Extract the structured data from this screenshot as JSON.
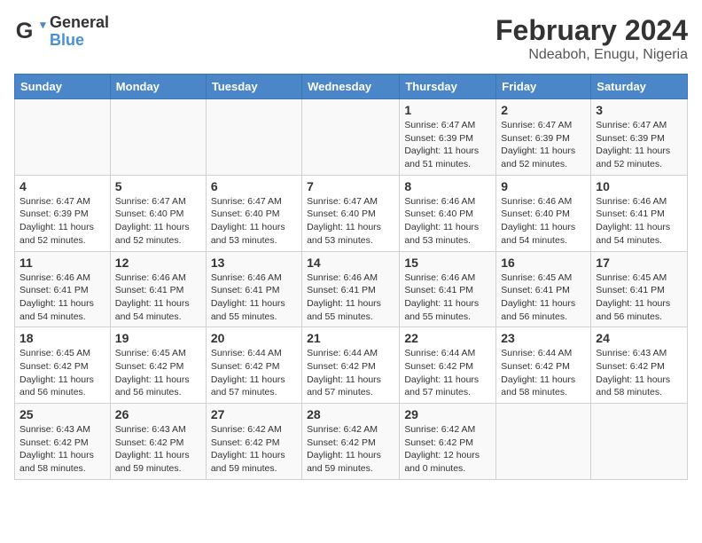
{
  "logo": {
    "line1": "General",
    "line2": "Blue"
  },
  "title": "February 2024",
  "subtitle": "Ndeaboh, Enugu, Nigeria",
  "days_of_week": [
    "Sunday",
    "Monday",
    "Tuesday",
    "Wednesday",
    "Thursday",
    "Friday",
    "Saturday"
  ],
  "weeks": [
    [
      {
        "num": "",
        "info": ""
      },
      {
        "num": "",
        "info": ""
      },
      {
        "num": "",
        "info": ""
      },
      {
        "num": "",
        "info": ""
      },
      {
        "num": "1",
        "info": "Sunrise: 6:47 AM\nSunset: 6:39 PM\nDaylight: 11 hours and 51 minutes."
      },
      {
        "num": "2",
        "info": "Sunrise: 6:47 AM\nSunset: 6:39 PM\nDaylight: 11 hours and 52 minutes."
      },
      {
        "num": "3",
        "info": "Sunrise: 6:47 AM\nSunset: 6:39 PM\nDaylight: 11 hours and 52 minutes."
      }
    ],
    [
      {
        "num": "4",
        "info": "Sunrise: 6:47 AM\nSunset: 6:39 PM\nDaylight: 11 hours and 52 minutes."
      },
      {
        "num": "5",
        "info": "Sunrise: 6:47 AM\nSunset: 6:40 PM\nDaylight: 11 hours and 52 minutes."
      },
      {
        "num": "6",
        "info": "Sunrise: 6:47 AM\nSunset: 6:40 PM\nDaylight: 11 hours and 53 minutes."
      },
      {
        "num": "7",
        "info": "Sunrise: 6:47 AM\nSunset: 6:40 PM\nDaylight: 11 hours and 53 minutes."
      },
      {
        "num": "8",
        "info": "Sunrise: 6:46 AM\nSunset: 6:40 PM\nDaylight: 11 hours and 53 minutes."
      },
      {
        "num": "9",
        "info": "Sunrise: 6:46 AM\nSunset: 6:40 PM\nDaylight: 11 hours and 54 minutes."
      },
      {
        "num": "10",
        "info": "Sunrise: 6:46 AM\nSunset: 6:41 PM\nDaylight: 11 hours and 54 minutes."
      }
    ],
    [
      {
        "num": "11",
        "info": "Sunrise: 6:46 AM\nSunset: 6:41 PM\nDaylight: 11 hours and 54 minutes."
      },
      {
        "num": "12",
        "info": "Sunrise: 6:46 AM\nSunset: 6:41 PM\nDaylight: 11 hours and 54 minutes."
      },
      {
        "num": "13",
        "info": "Sunrise: 6:46 AM\nSunset: 6:41 PM\nDaylight: 11 hours and 55 minutes."
      },
      {
        "num": "14",
        "info": "Sunrise: 6:46 AM\nSunset: 6:41 PM\nDaylight: 11 hours and 55 minutes."
      },
      {
        "num": "15",
        "info": "Sunrise: 6:46 AM\nSunset: 6:41 PM\nDaylight: 11 hours and 55 minutes."
      },
      {
        "num": "16",
        "info": "Sunrise: 6:45 AM\nSunset: 6:41 PM\nDaylight: 11 hours and 56 minutes."
      },
      {
        "num": "17",
        "info": "Sunrise: 6:45 AM\nSunset: 6:41 PM\nDaylight: 11 hours and 56 minutes."
      }
    ],
    [
      {
        "num": "18",
        "info": "Sunrise: 6:45 AM\nSunset: 6:42 PM\nDaylight: 11 hours and 56 minutes."
      },
      {
        "num": "19",
        "info": "Sunrise: 6:45 AM\nSunset: 6:42 PM\nDaylight: 11 hours and 56 minutes."
      },
      {
        "num": "20",
        "info": "Sunrise: 6:44 AM\nSunset: 6:42 PM\nDaylight: 11 hours and 57 minutes."
      },
      {
        "num": "21",
        "info": "Sunrise: 6:44 AM\nSunset: 6:42 PM\nDaylight: 11 hours and 57 minutes."
      },
      {
        "num": "22",
        "info": "Sunrise: 6:44 AM\nSunset: 6:42 PM\nDaylight: 11 hours and 57 minutes."
      },
      {
        "num": "23",
        "info": "Sunrise: 6:44 AM\nSunset: 6:42 PM\nDaylight: 11 hours and 58 minutes."
      },
      {
        "num": "24",
        "info": "Sunrise: 6:43 AM\nSunset: 6:42 PM\nDaylight: 11 hours and 58 minutes."
      }
    ],
    [
      {
        "num": "25",
        "info": "Sunrise: 6:43 AM\nSunset: 6:42 PM\nDaylight: 11 hours and 58 minutes."
      },
      {
        "num": "26",
        "info": "Sunrise: 6:43 AM\nSunset: 6:42 PM\nDaylight: 11 hours and 59 minutes."
      },
      {
        "num": "27",
        "info": "Sunrise: 6:42 AM\nSunset: 6:42 PM\nDaylight: 11 hours and 59 minutes."
      },
      {
        "num": "28",
        "info": "Sunrise: 6:42 AM\nSunset: 6:42 PM\nDaylight: 11 hours and 59 minutes."
      },
      {
        "num": "29",
        "info": "Sunrise: 6:42 AM\nSunset: 6:42 PM\nDaylight: 12 hours and 0 minutes."
      },
      {
        "num": "",
        "info": ""
      },
      {
        "num": "",
        "info": ""
      }
    ]
  ]
}
